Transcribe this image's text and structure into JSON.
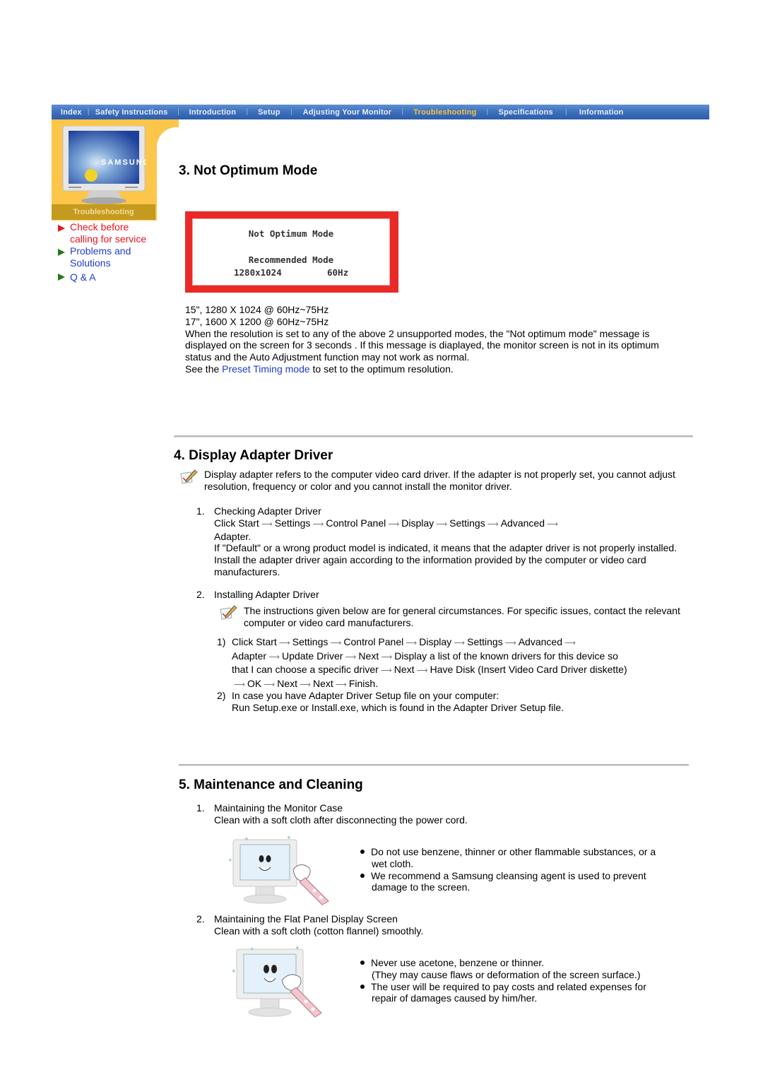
{
  "nav": {
    "items": [
      {
        "label": "Index",
        "active": false
      },
      {
        "label": "Safety Instructions",
        "active": false
      },
      {
        "label": "Introduction",
        "active": false
      },
      {
        "label": "Setup",
        "active": false
      },
      {
        "label": "Adjusting Your Monitor",
        "active": false
      },
      {
        "label": "Troubleshooting",
        "active": true
      },
      {
        "label": "Specifications",
        "active": false
      },
      {
        "label": "Information",
        "active": false
      }
    ]
  },
  "sidebar": {
    "image_brand": "SAMSUNG",
    "banner": "Troubleshooting",
    "links": [
      {
        "label_line1": "Check before",
        "label_line2": "calling for service",
        "color": "#e8141c"
      },
      {
        "label_line1": "Problems and",
        "label_line2": "Solutions",
        "color": "#1f3dcc"
      },
      {
        "label_line1": "Q & A",
        "label_line2": "",
        "color": "#1f3dcc"
      }
    ]
  },
  "section3": {
    "title": "3. Not Optimum Mode",
    "osd": {
      "line1": "Not Optimum Mode",
      "line2": "Recommended Mode",
      "resolution": "1280x1024",
      "frequency": "60Hz"
    },
    "modes": [
      "15\", 1280 X 1024 @ 60Hz~75Hz",
      "17\", 1600 X 1200 @ 60Hz~75Hz"
    ],
    "paragraph": "When the resolution is set to any of the above 2 unsupported modes, the \"Not optimum mode\" message is displayed on the screen for 3 seconds . If this message is diaplayed, the monitor screen is not in its optimum status and the Auto Adjustment function may not work as normal.",
    "see_prefix": "See the ",
    "see_link": "Preset Timing mode",
    "see_suffix": " to set to the optimum resolution."
  },
  "section4": {
    "title": "4. Display Adapter Driver",
    "note": "Display adapter refers to the computer video card driver. If the adapter is not properly set, you cannot adjust resolution, frequency or color and you cannot install the monitor driver.",
    "item1": {
      "number": "1.",
      "title": "Checking Adapter Driver",
      "path": [
        "Click Start",
        "Settings",
        "Control Panel",
        "Display",
        "Settings",
        "Advanced"
      ],
      "path_end": "Adapter.",
      "text": "If \"Default\" or a wrong product model is indicated, it means that the adapter driver is not properly installed. Install the adapter driver again according to the information provided by the computer or video card manufacturers."
    },
    "item2": {
      "number": "2.",
      "title": "Installing Adapter Driver",
      "note": "The instructions given below are for general circumstances. For specific issues, contact the relevant computer or video card manufacturers.",
      "step1": {
        "number": "1)",
        "line1": [
          "Click Start",
          "Settings",
          "Control Panel",
          "Display",
          "Settings",
          "Advanced"
        ],
        "line2": [
          "Adapter",
          "Update Driver",
          "Next",
          "Display a list of the known drivers for this device so"
        ],
        "line3": [
          "that I can choose a specific driver",
          "Next",
          "Have Disk (Insert Video Card Driver diskette)"
        ],
        "line4": [
          "OK",
          "Next",
          "Next",
          "Finish."
        ]
      },
      "step2": {
        "number": "2)",
        "line1": "In case you have Adapter Driver Setup file on your computer:",
        "line2": "Run Setup.exe or Install.exe, which is found in the Adapter Driver Setup file."
      }
    }
  },
  "section5": {
    "title": "5. Maintenance and Cleaning",
    "item1": {
      "number": "1.",
      "title": "Maintaining the Monitor Case",
      "text": "Clean with a soft cloth after disconnecting the power cord.",
      "bullets": [
        {
          "line1": "Do not use benzene, thinner or other flammable substances, or a",
          "line2": "wet cloth."
        },
        {
          "line1": "We recommend a Samsung cleansing agent is used to prevent",
          "line2": "damage to the screen."
        }
      ]
    },
    "item2": {
      "number": "2.",
      "title": "Maintaining the Flat Panel Display Screen",
      "text": "Clean with a soft cloth (cotton flannel) smoothly.",
      "bullets": [
        {
          "line1": "Never use acetone, benzene or thinner.",
          "line2": "(They may cause flaws or deformation of the screen surface.)"
        },
        {
          "line1": "The user will be required to pay costs and related expenses for",
          "line2": "repair of damages caused by him/her."
        }
      ]
    }
  }
}
